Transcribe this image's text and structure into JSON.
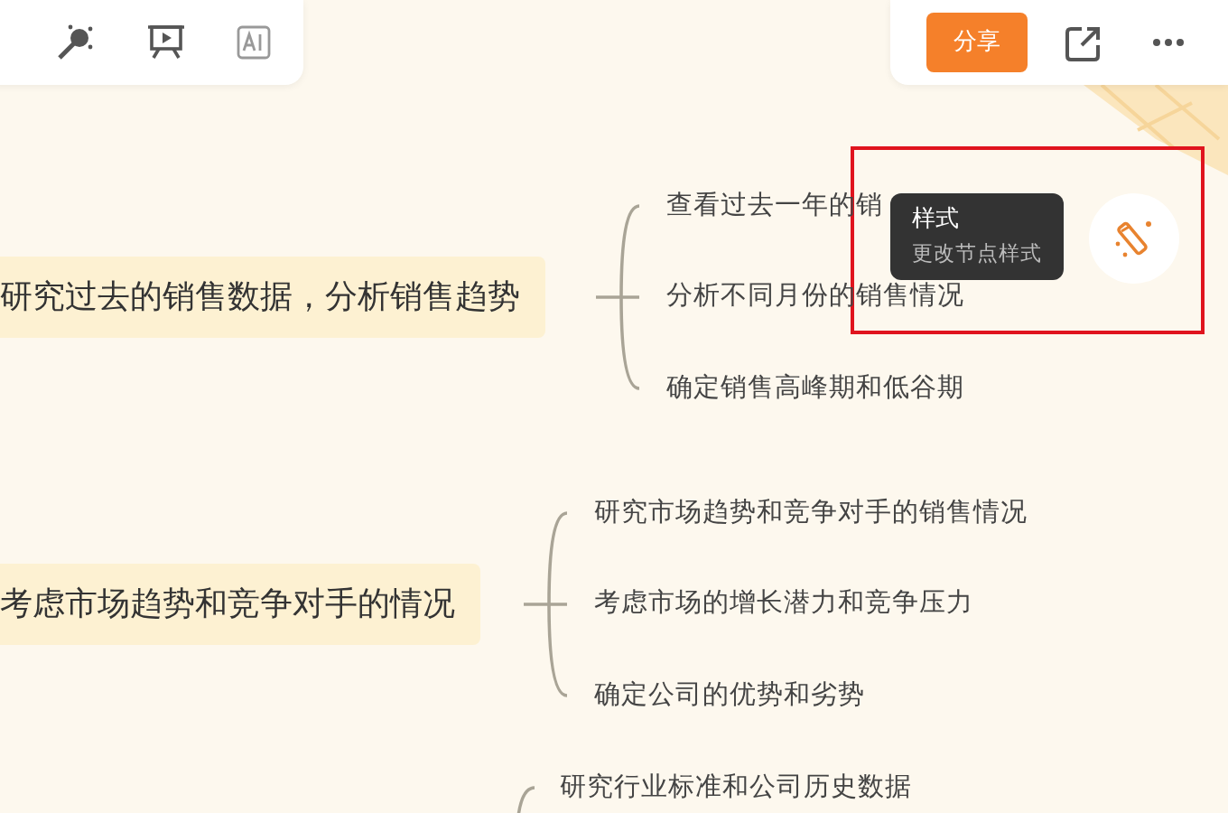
{
  "share_button": {
    "label": "分享"
  },
  "topics": [
    {
      "label": "研究过去的销售数据，分析销售趋势",
      "children": [
        {
          "label": "查看过去一年的销"
        },
        {
          "label": "分析不同月份的销售情况"
        },
        {
          "label": "确定销售高峰期和低谷期"
        }
      ]
    },
    {
      "label": "考虑市场趋势和竞争对手的情况",
      "children": [
        {
          "label": "研究市场趋势和竞争对手的销售情况"
        },
        {
          "label": "考虑市场的增长潜力和竞争压力"
        },
        {
          "label": "确定公司的优势和劣势"
        }
      ]
    },
    {
      "children": [
        {
          "label": "研究行业标准和公司历史数据"
        }
      ]
    }
  ],
  "tooltip": {
    "title": "样式",
    "subtitle": "更改节点样式"
  }
}
